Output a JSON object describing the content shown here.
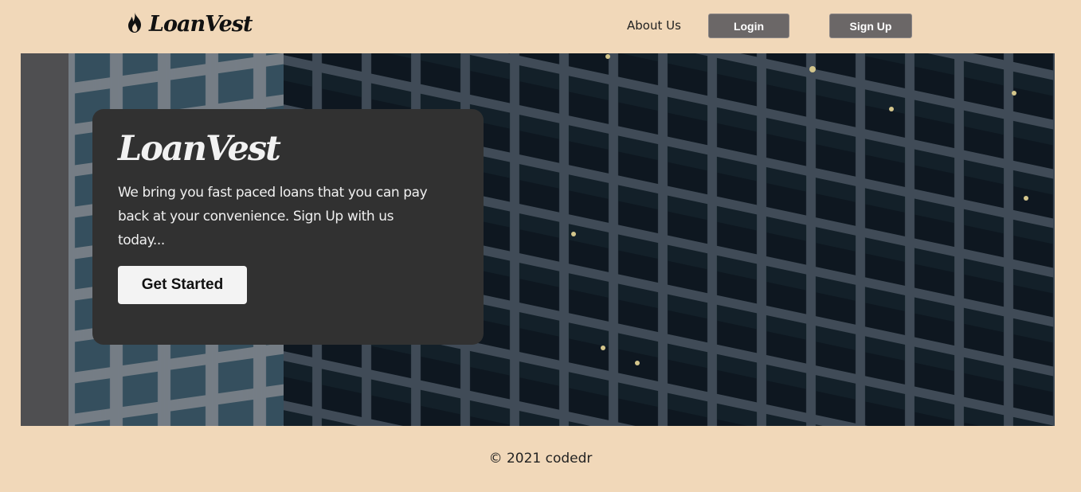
{
  "header": {
    "brand": "LoanVest",
    "brand_icon": "flame-icon",
    "nav": {
      "about": "About Us",
      "login": "Login",
      "signup": "Sign Up"
    }
  },
  "hero": {
    "background": "office-building-facade-image",
    "card": {
      "title": "LoanVest",
      "text": "We bring you fast paced loans that you can pay back at your convenience. Sign Up with us today...",
      "cta": "Get Started"
    }
  },
  "footer": {
    "copyright": "© 2021 codedr"
  },
  "colors": {
    "page_bg": "#f1d8b9",
    "nav_button_bg": "#6b6767",
    "card_bg": "#313131",
    "cta_bg": "#f3f3f3"
  }
}
